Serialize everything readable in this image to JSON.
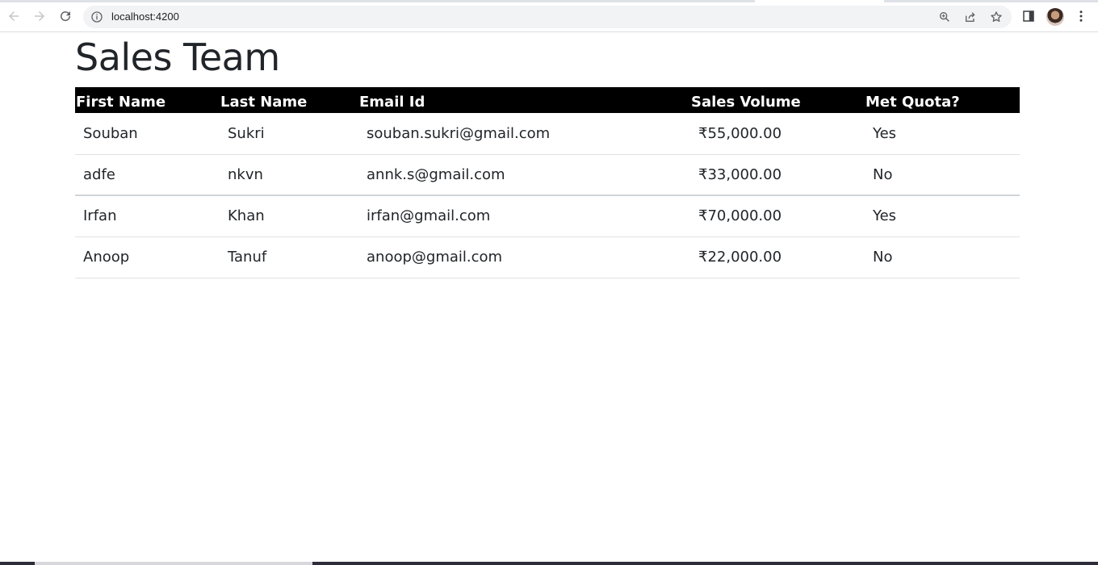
{
  "browser": {
    "url": "localhost:4200",
    "icons": [
      "back-icon",
      "forward-icon",
      "reload-icon",
      "info-icon",
      "zoom-icon",
      "share-icon",
      "bookmark-star-icon",
      "side-panel-icon",
      "profile-avatar",
      "more-menu-icon"
    ]
  },
  "page": {
    "title": "Sales Team"
  },
  "table": {
    "headers": [
      "First Name",
      "Last Name",
      "Email Id",
      "Sales Volume",
      "Met Quota?"
    ],
    "rows": [
      [
        "Souban",
        "Sukri",
        "souban.sukri@gmail.com",
        "₹55,000.00",
        "Yes"
      ],
      [
        "adfe",
        "nkvn",
        "annk.s@gmail.com",
        "₹33,000.00",
        "No"
      ],
      [
        "Irfan",
        "Khan",
        "irfan@gmail.com",
        "₹70,000.00",
        "Yes"
      ],
      [
        "Anoop",
        "Tanuf",
        "anoop@gmail.com",
        "₹22,000.00",
        "No"
      ]
    ]
  },
  "colors": {
    "header_bg": "#000000",
    "header_text": "#ffffff",
    "body_text": "#212529",
    "row_border": "#dee2e6"
  }
}
